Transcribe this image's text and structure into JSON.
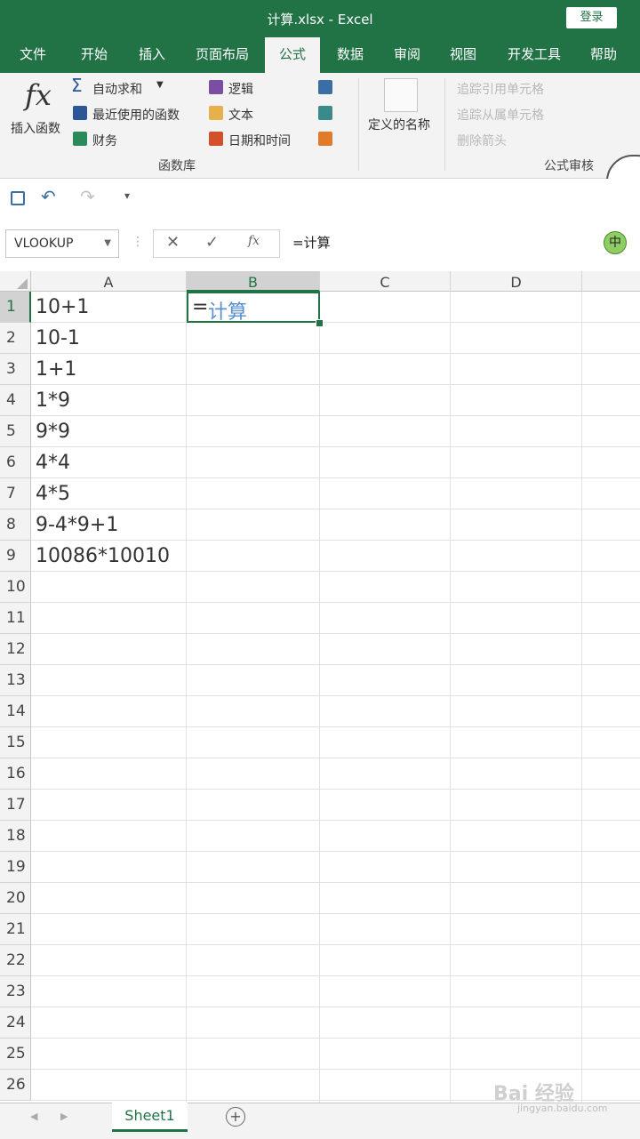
{
  "window": {
    "title": "计算.xlsx  -  Excel",
    "login_label": "登录"
  },
  "ribbon_tabs": [
    "文件",
    "开始",
    "插入",
    "页面布局",
    "公式",
    "数据",
    "审阅",
    "视图",
    "开发工具",
    "帮助"
  ],
  "ribbon": {
    "insert_function_label": "插入函数",
    "fx_glyph": "fx",
    "autosum": "自动求和",
    "recent": "最近使用的函数",
    "financial": "财务",
    "logical": "逻辑",
    "text": "文本",
    "datetime": "日期和时间",
    "define_name": "定义的名称",
    "library_group": "函数库",
    "trace_precedents": "追踪引用单元格",
    "trace_dependents": "追踪从属单元格",
    "remove_arrows": "删除箭头",
    "audit_group": "公式审核"
  },
  "formula_bar": {
    "name_box": "VLOOKUP",
    "fx_label": "fx",
    "formula": "=计算"
  },
  "grid": {
    "columns": [
      "A",
      "B",
      "C",
      "D"
    ],
    "rows": [
      "1",
      "2",
      "3",
      "4",
      "5",
      "6",
      "7",
      "8",
      "9",
      "10",
      "11",
      "12",
      "13",
      "14",
      "15",
      "16",
      "17",
      "18",
      "19",
      "20",
      "21",
      "22",
      "23",
      "24",
      "25",
      "26"
    ],
    "column_a": [
      "10+1",
      "10-1",
      "1+1",
      "1*9",
      "9*9",
      "4*4",
      "4*5",
      "9-4*9+1",
      "10086*10010"
    ],
    "b1_prefix": "=",
    "b1_text": "计算"
  },
  "ime": {
    "label": "中"
  },
  "sheets": {
    "active": "Sheet1"
  },
  "watermark": {
    "main": "Bai 经验",
    "sub": "jingyan.baidu.com"
  },
  "colors": {
    "accent": "#217346",
    "ribbon_bg": "#f3f3f3"
  }
}
